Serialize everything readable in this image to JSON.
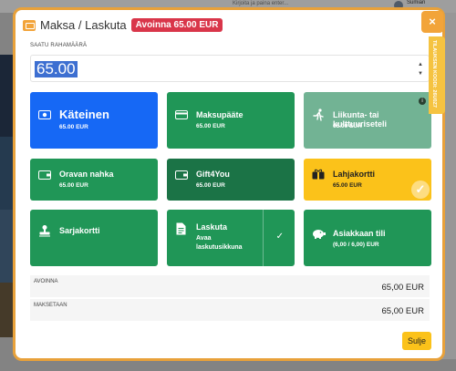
{
  "background": {
    "search_placeholder": "Kirjoita ja paina enter...",
    "user_name": "Sumiari"
  },
  "modal": {
    "title": "Maksa / Laskuta",
    "open_badge": "Avoinna 65.00 EUR",
    "amount_label": "SAATU RAHAMÄÄRÄ",
    "amount_value": "65.00",
    "close_icon_label": "×",
    "side_tab": "TILAUKSEN KOODI: 26U0Z7",
    "tiles": [
      {
        "name": "Käteinen",
        "sub": "65.00 EUR",
        "color": "#1668f5",
        "icon": "cash-icon"
      },
      {
        "name": "Maksupääte",
        "sub": "65.00 EUR",
        "color": "#209657",
        "icon": "card-terminal-icon"
      },
      {
        "name": "Liikunta- tai kulttuuriseteli",
        "sub": "65.00 EUR",
        "color": "#72b394",
        "icon": "running-person-icon"
      },
      {
        "name": "Oravan nahka",
        "sub": "65.00 EUR",
        "color": "#209657",
        "icon": "wallet-icon"
      },
      {
        "name": "Gift4You",
        "sub": "65.00 EUR",
        "color": "#1b7346",
        "icon": "wallet-icon"
      },
      {
        "name": "Lahjakortti",
        "sub": "65.00 EUR",
        "color": "#fbc21a",
        "icon": "gift-card-icon"
      },
      {
        "name": "Sarjakortti",
        "sub": "",
        "color": "#209657",
        "icon": "stamp-icon"
      },
      {
        "name": "Laskuta",
        "sub": "Avaa laskutusikkuna",
        "color": "#209657",
        "icon": "invoice-icon"
      },
      {
        "name": "Asiakkaan tili",
        "sub": "(6,00 / 6,00) EUR",
        "color": "#209657",
        "icon": "piggy-bank-icon"
      }
    ],
    "summary": [
      {
        "label": "AVOINNA",
        "value": "65,00 EUR"
      },
      {
        "label": "MAKSETAAN",
        "value": "65,00 EUR"
      }
    ],
    "close_button": "Sulje"
  }
}
